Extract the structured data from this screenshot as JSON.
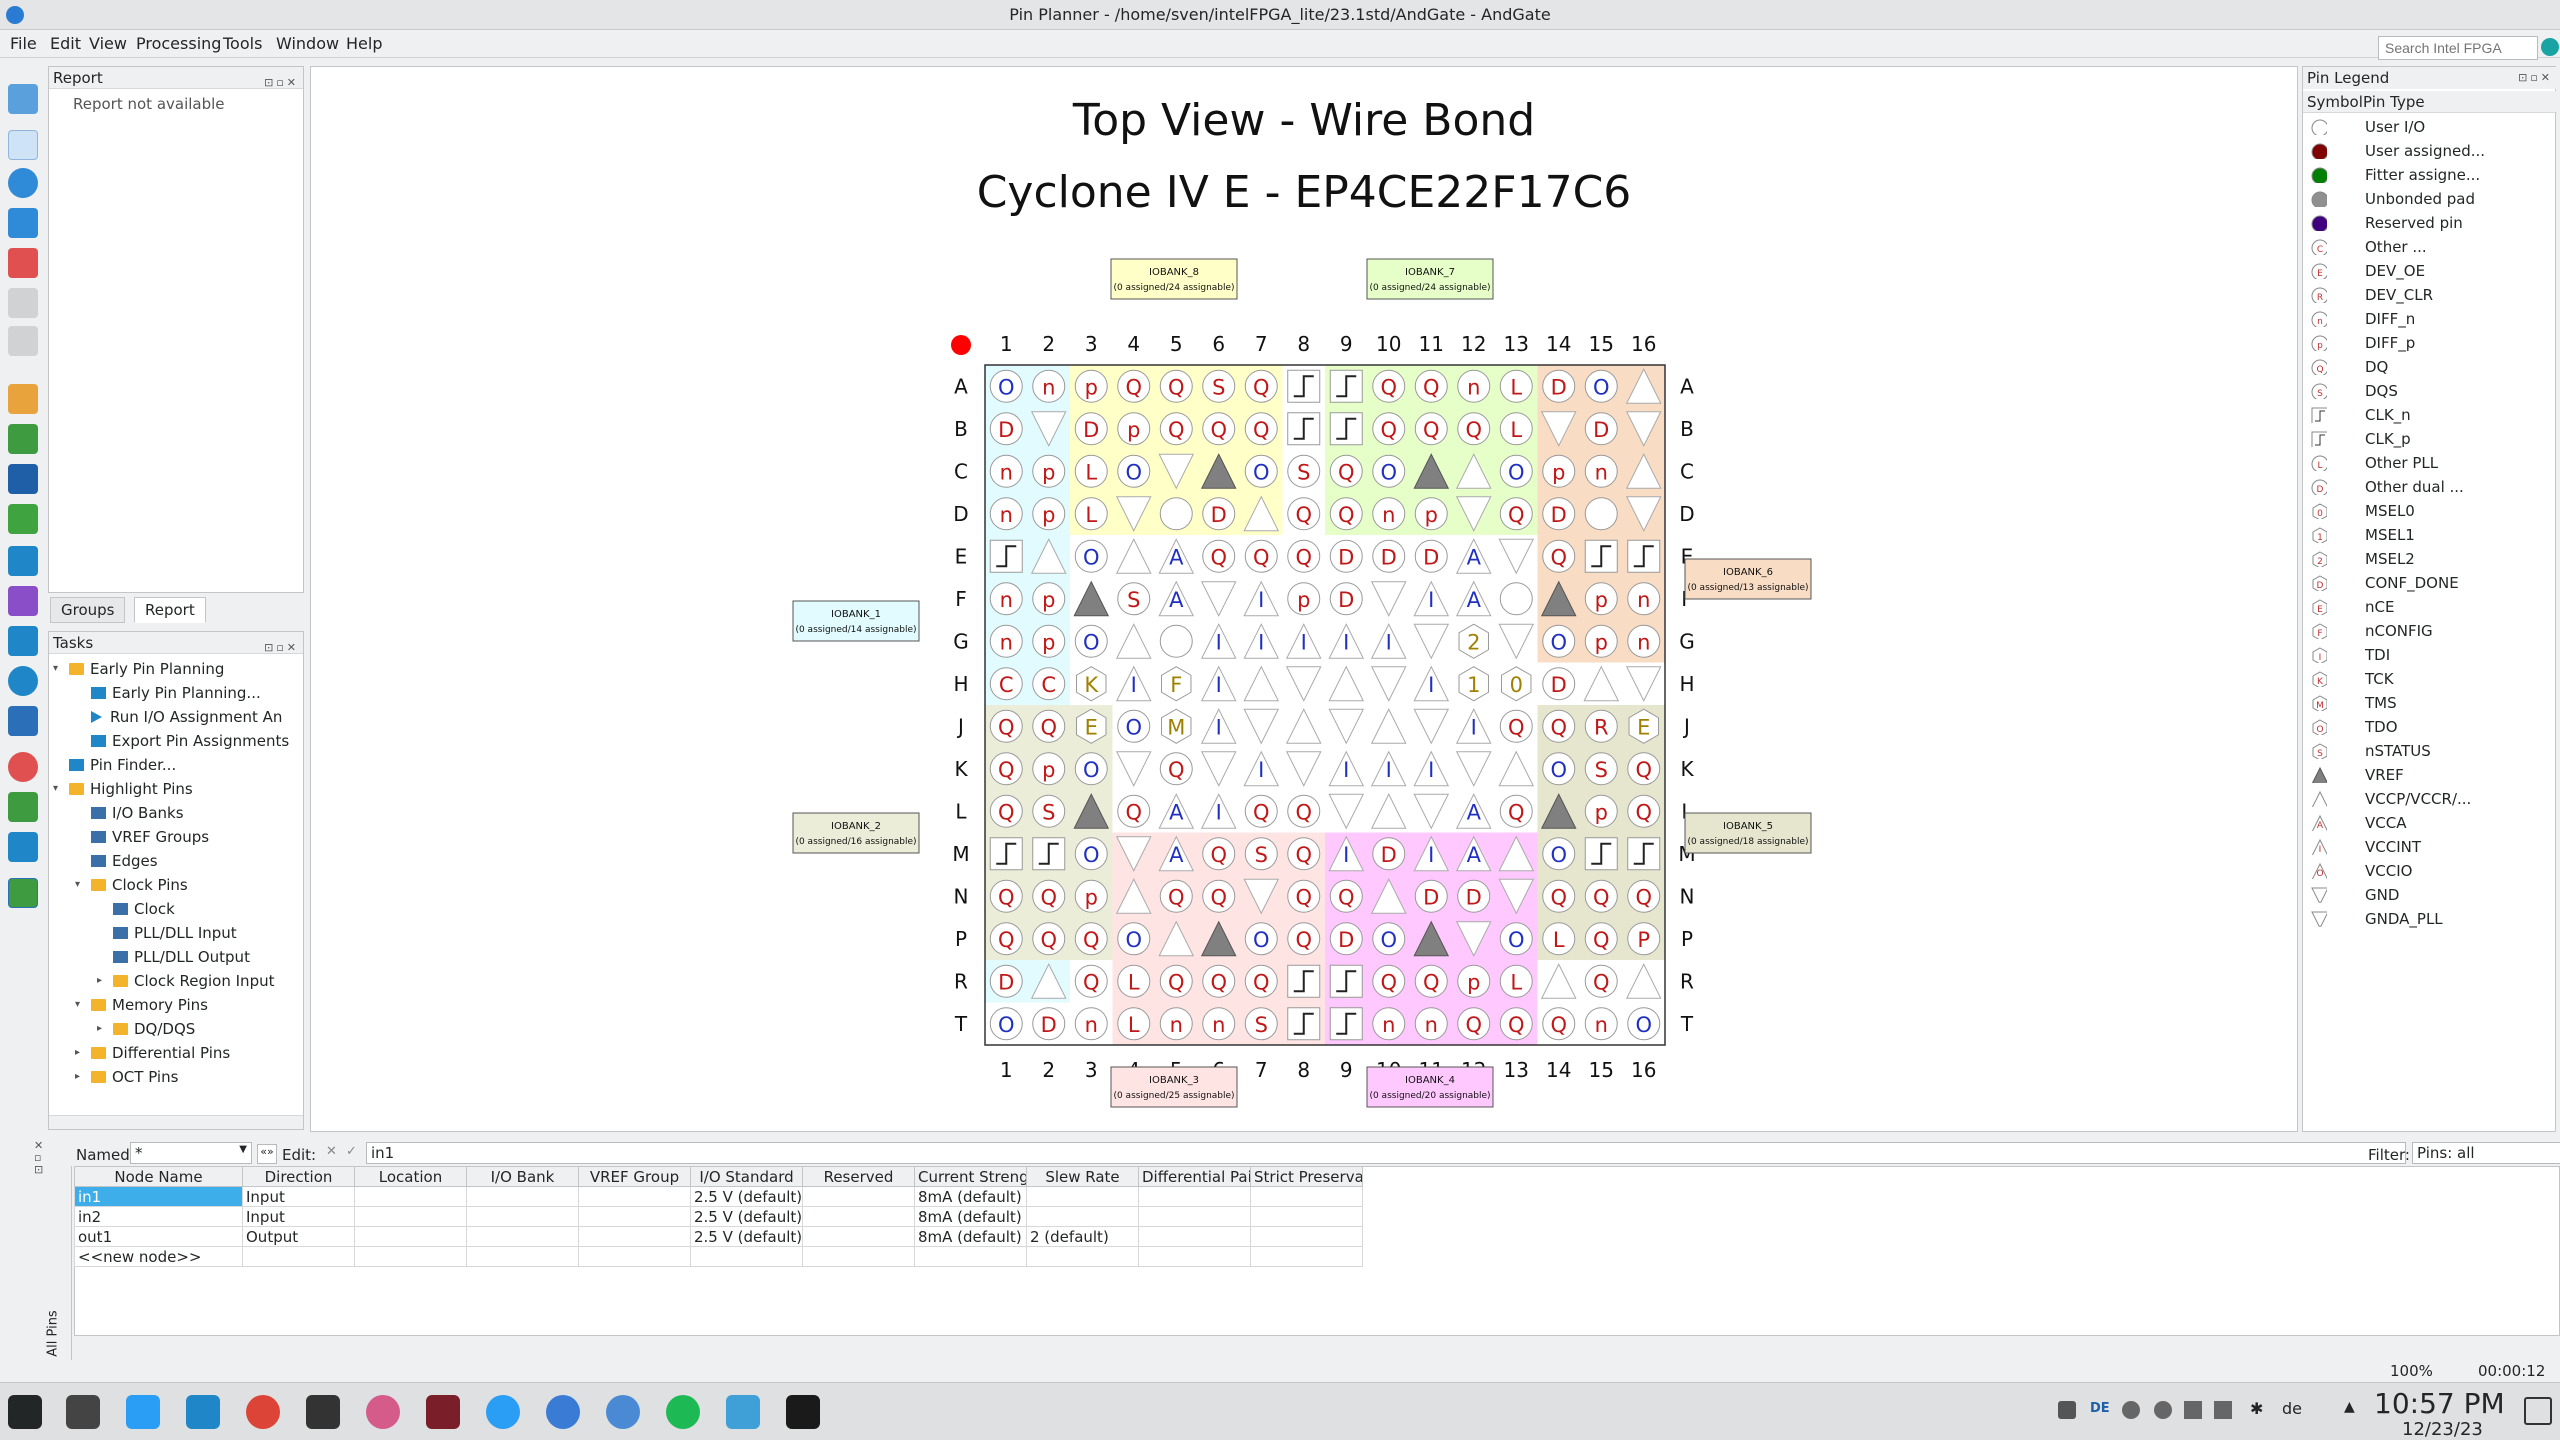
{
  "window": {
    "title": "Pin Planner - /home/sven/intelFPGA_lite/23.1std/AndGate - AndGate"
  },
  "menu": [
    "File",
    "Edit",
    "View",
    "Processing",
    "Tools",
    "Window",
    "Help"
  ],
  "search": {
    "placeholder": "Search Intel FPGA"
  },
  "report_panel": {
    "title": "Report",
    "message": "Report not available"
  },
  "tabs": [
    "Groups",
    "Report"
  ],
  "tasks_panel": {
    "title": "Tasks",
    "items": [
      {
        "label": "Early Pin Planning",
        "indent": 1,
        "icon": "folder",
        "expander": "open"
      },
      {
        "label": "Early Pin Planning...",
        "indent": 2,
        "icon": "pin-planner"
      },
      {
        "label": "Run I/O Assignment An",
        "indent": 2,
        "icon": "run"
      },
      {
        "label": "Export Pin Assignments",
        "indent": 2,
        "icon": "pin-planner"
      },
      {
        "label": "Pin Finder...",
        "indent": 1,
        "icon": "pin-planner"
      },
      {
        "label": "Highlight Pins",
        "indent": 1,
        "icon": "folder",
        "expander": "open"
      },
      {
        "label": "I/O Banks",
        "indent": 2,
        "icon": "grid"
      },
      {
        "label": "VREF Groups",
        "indent": 2,
        "icon": "grid"
      },
      {
        "label": "Edges",
        "indent": 2,
        "icon": "grid"
      },
      {
        "label": "Clock Pins",
        "indent": 2,
        "icon": "folder",
        "expander": "open"
      },
      {
        "label": "Clock",
        "indent": 3,
        "icon": "grid"
      },
      {
        "label": "PLL/DLL Input",
        "indent": 3,
        "icon": "grid"
      },
      {
        "label": "PLL/DLL Output",
        "indent": 3,
        "icon": "grid"
      },
      {
        "label": "Clock Region Input",
        "indent": 3,
        "icon": "folder",
        "expander": "closed"
      },
      {
        "label": "Memory Pins",
        "indent": 2,
        "icon": "folder",
        "expander": "open"
      },
      {
        "label": "DQ/DQS",
        "indent": 3,
        "icon": "folder",
        "expander": "closed"
      },
      {
        "label": "Differential Pins",
        "indent": 2,
        "icon": "folder",
        "expander": "closed"
      },
      {
        "label": "OCT Pins",
        "indent": 2,
        "icon": "folder",
        "expander": "closed"
      }
    ]
  },
  "view": {
    "title1": "Top View - Wire Bond",
    "title2": "Cyclone IV E - EP4CE22F17C6",
    "columns": [
      "1",
      "2",
      "3",
      "4",
      "5",
      "6",
      "7",
      "8",
      "9",
      "10",
      "11",
      "12",
      "13",
      "14",
      "15",
      "16"
    ],
    "rows": [
      "A",
      "B",
      "C",
      "D",
      "E",
      "F",
      "G",
      "H",
      "J",
      "K",
      "L",
      "M",
      "N",
      "P",
      "R",
      "T"
    ],
    "pins": [
      "OnpQQSQCCQQnLDO",
      "D-DpQQQKKQQQL-D",
      "npLO-VOSQOV-Opn",
      "npL- D-QQ-np-QD ",
      "C-O-AQQDDD-A-QKC",
      "np-VSA-Ip-IA V-pn",
      "np-O-I-IIII-2-Opn",
      "CCKIF-I-----I10D",
      "QQEOMI---- I-QQRE",
      "QpO-Q-I-III--OSQ",
      "QSVQAIQQ----AQVpQ",
      "CCO-AQSQIDIA-OCC",
      "QQp-QQ-QQDDD-QQQ",
      "QQQO-VOQDOV-OLQP",
      "D-QLQQQKKQQpL-Q",
      "ODnLnnSCCnnQQQnO"
    ],
    "pin_grid": [
      [
        "O",
        "n",
        "p",
        "Q",
        "Q",
        "S",
        "Q",
        "⎍",
        "⎍",
        "Q",
        "Q",
        "n",
        "L",
        "D",
        "O",
        ""
      ],
      [
        "D",
        "",
        "D",
        "p",
        "Q",
        "Q",
        "Q",
        "⎍",
        "⎍",
        "Q",
        "Q",
        "Q",
        "L",
        "",
        "D",
        ""
      ],
      [
        "n",
        "p",
        "L",
        "O",
        "",
        "▲",
        "O",
        "S",
        "Q",
        "O",
        "▲",
        "",
        "O",
        "p",
        "n",
        ""
      ],
      [
        "n",
        "p",
        "L",
        "",
        "○",
        "D",
        "",
        "Q",
        "Q",
        "n",
        "p",
        "",
        "Q",
        "D",
        "○",
        ""
      ],
      [
        "⎍",
        "",
        "O",
        "",
        "A",
        "Q",
        "Q",
        "Q",
        "D",
        "D",
        "D",
        "A",
        "",
        "Q",
        "⎍",
        "⎍"
      ],
      [
        "n",
        "p",
        "▲",
        "S",
        "A",
        "",
        "I",
        "p",
        "D",
        "",
        "I",
        "A",
        "○",
        "▲",
        "p",
        "n"
      ],
      [
        "n",
        "p",
        "O",
        "",
        "○",
        "I",
        "I",
        "I",
        "I",
        "I",
        "",
        "2",
        "",
        "O",
        "p",
        "n"
      ],
      [
        "C",
        "C",
        "K",
        "I",
        "F",
        "I",
        "",
        "",
        "",
        "",
        "I",
        "1",
        "0",
        "D",
        "",
        ""
      ],
      [
        "Q",
        "Q",
        "E",
        "O",
        "M",
        "I",
        "",
        "",
        "",
        "",
        "",
        "I",
        "Q",
        "Q",
        "R",
        "E"
      ],
      [
        "Q",
        "p",
        "O",
        "",
        "Q",
        "",
        "I",
        "",
        "I",
        "I",
        "I",
        "",
        "",
        "O",
        "S",
        "Q"
      ],
      [
        "Q",
        "S",
        "▲",
        "Q",
        "A",
        "I",
        "Q",
        "Q",
        "",
        "",
        "",
        "A",
        "Q",
        "▲",
        "p",
        "Q"
      ],
      [
        "⎍",
        "⎍",
        "O",
        "",
        "A",
        "Q",
        "S",
        "Q",
        "I",
        "D",
        "I",
        "A",
        "",
        "O",
        "⎍",
        "⎍"
      ],
      [
        "Q",
        "Q",
        "p",
        "",
        "Q",
        "Q",
        "",
        "Q",
        "Q",
        "",
        "D",
        "D",
        "",
        "Q",
        "Q",
        "Q"
      ],
      [
        "Q",
        "Q",
        "Q",
        "O",
        "",
        "▲",
        "O",
        "Q",
        "D",
        "O",
        "▲",
        "",
        "O",
        "L",
        "Q",
        "P"
      ],
      [
        "D",
        "",
        "Q",
        "L",
        "Q",
        "Q",
        "Q",
        "⎍",
        "⎍",
        "Q",
        "Q",
        "p",
        "L",
        "",
        "Q",
        ""
      ],
      [
        "O",
        "D",
        "n",
        "L",
        "n",
        "n",
        "S",
        "⎍",
        "⎍",
        "n",
        "n",
        "Q",
        "Q",
        "Q",
        "n",
        "O"
      ]
    ],
    "banks": [
      {
        "name": "IOBANK_8",
        "info": "(0 assigned/24 assignable)",
        "color": "#ffffc8"
      },
      {
        "name": "IOBANK_7",
        "info": "(0 assigned/24 assignable)",
        "color": "#e6ffc8"
      },
      {
        "name": "IOBANK_1",
        "info": "(0 assigned/14 assignable)",
        "color": "#e1fbff"
      },
      {
        "name": "IOBANK_6",
        "info": "(0 assigned/13 assignable)",
        "color": "#f8dcc4"
      },
      {
        "name": "IOBANK_2",
        "info": "(0 assigned/16 assignable)",
        "color": "#ebedd8"
      },
      {
        "name": "IOBANK_5",
        "info": "(0 assigned/18 assignable)",
        "color": "#e6e6cf"
      },
      {
        "name": "IOBANK_3",
        "info": "(0 assigned/25 assignable)",
        "color": "#ffe4e4"
      },
      {
        "name": "IOBANK_4",
        "info": "(0 assigned/20 assignable)",
        "color": "#ffc8ff"
      }
    ]
  },
  "legend": {
    "title": "Pin Legend",
    "col_symbol": "Symbol",
    "col_type": "Pin Type",
    "items": [
      {
        "sym": "",
        "label": "User I/O",
        "shape": "circle",
        "color": "#ffffff"
      },
      {
        "sym": "",
        "label": "User assigned...",
        "shape": "circle",
        "color": "#800000"
      },
      {
        "sym": "",
        "label": "Fitter assigne...",
        "shape": "circle",
        "color": "#008000"
      },
      {
        "sym": "",
        "label": "Unbonded pad",
        "shape": "circle",
        "color": "#909090"
      },
      {
        "sym": "",
        "label": "Reserved pin",
        "shape": "circle",
        "color": "#400080"
      },
      {
        "sym": "C",
        "label": "Other ...",
        "shape": "circle",
        "color": "#ffffff"
      },
      {
        "sym": "E",
        "label": "DEV_OE",
        "shape": "circle",
        "color": "#ffffff"
      },
      {
        "sym": "R",
        "label": "DEV_CLR",
        "shape": "circle",
        "color": "#ffffff"
      },
      {
        "sym": "n",
        "label": "DIFF_n",
        "shape": "circle",
        "color": "#ffffff"
      },
      {
        "sym": "p",
        "label": "DIFF_p",
        "shape": "circle",
        "color": "#ffffff"
      },
      {
        "sym": "Q",
        "label": "DQ",
        "shape": "circle",
        "color": "#ffffff"
      },
      {
        "sym": "S",
        "label": "DQS",
        "shape": "circle",
        "color": "#ffffff"
      },
      {
        "sym": "",
        "label": "CLK_n",
        "shape": "clk",
        "color": "#ffffff"
      },
      {
        "sym": "",
        "label": "CLK_p",
        "shape": "clk",
        "color": "#ffffff"
      },
      {
        "sym": "L",
        "label": "Other PLL",
        "shape": "circle",
        "color": "#ffffff"
      },
      {
        "sym": "D",
        "label": "Other dual ...",
        "shape": "circle",
        "color": "#ffffff"
      },
      {
        "sym": "0",
        "label": "MSEL0",
        "shape": "hex",
        "color": "#ffffff"
      },
      {
        "sym": "1",
        "label": "MSEL1",
        "shape": "hex",
        "color": "#ffffff"
      },
      {
        "sym": "2",
        "label": "MSEL2",
        "shape": "hex",
        "color": "#ffffff"
      },
      {
        "sym": "D",
        "label": "CONF_DONE",
        "shape": "hex",
        "color": "#ffffff"
      },
      {
        "sym": "E",
        "label": "nCE",
        "shape": "hex",
        "color": "#ffffff"
      },
      {
        "sym": "F",
        "label": "nCONFIG",
        "shape": "hex",
        "color": "#ffffff"
      },
      {
        "sym": "I",
        "label": "TDI",
        "shape": "hex",
        "color": "#ffffff"
      },
      {
        "sym": "K",
        "label": "TCK",
        "shape": "hex",
        "color": "#ffffff"
      },
      {
        "sym": "M",
        "label": "TMS",
        "shape": "hex",
        "color": "#ffffff"
      },
      {
        "sym": "O",
        "label": "TDO",
        "shape": "hex",
        "color": "#ffffff"
      },
      {
        "sym": "S",
        "label": "nSTATUS",
        "shape": "hex",
        "color": "#ffffff"
      },
      {
        "sym": "",
        "label": "VREF",
        "shape": "tri-fill",
        "color": "#808080"
      },
      {
        "sym": "",
        "label": "VCCP/VCCR/...",
        "shape": "tri",
        "color": "#ffffff"
      },
      {
        "sym": "A",
        "label": "VCCA",
        "shape": "tri",
        "color": "#ffffff"
      },
      {
        "sym": "I",
        "label": "VCCINT",
        "shape": "tri",
        "color": "#ffffff"
      },
      {
        "sym": "O",
        "label": "VCCIO",
        "shape": "tri",
        "color": "#ffffff"
      },
      {
        "sym": "",
        "label": "GND",
        "shape": "tri-down",
        "color": "#ffffff"
      },
      {
        "sym": "",
        "label": "GNDA_PLL",
        "shape": "tri-down",
        "color": "#ffffff"
      }
    ]
  },
  "filter": {
    "named_label": "Named:",
    "named_value": "*",
    "edit_label": "Edit:",
    "edit_value": "in1",
    "filter_label": "Filter:",
    "filter_value": "Pins: all"
  },
  "all_pins_label": "All Pins",
  "table": {
    "headers": [
      "Node Name",
      "Direction",
      "Location",
      "I/O Bank",
      "VREF Group",
      "I/O Standard",
      "Reserved",
      "Current Strength",
      "Slew Rate",
      "Differential Pair",
      "Strict Preservation"
    ],
    "rows": [
      [
        "in1",
        "Input",
        "",
        "",
        "",
        "2.5 V (default)",
        "",
        "8mA (default)",
        "",
        "",
        ""
      ],
      [
        "in2",
        "Input",
        "",
        "",
        "",
        "2.5 V (default)",
        "",
        "8mA (default)",
        "",
        "",
        ""
      ],
      [
        "out1",
        "Output",
        "",
        "",
        "",
        "2.5 V (default)",
        "",
        "8mA (default)",
        "2 (default)",
        "",
        ""
      ],
      [
        "<<new node>>",
        "",
        "",
        "",
        "",
        "",
        "",
        "",
        "",
        "",
        ""
      ]
    ]
  },
  "status": {
    "zoom": "100%",
    "time": "00:00:12"
  },
  "taskbar": {
    "keyboard": "de",
    "clock": "10:57 PM",
    "date": "12/23/23",
    "lang_tray": "DE"
  }
}
